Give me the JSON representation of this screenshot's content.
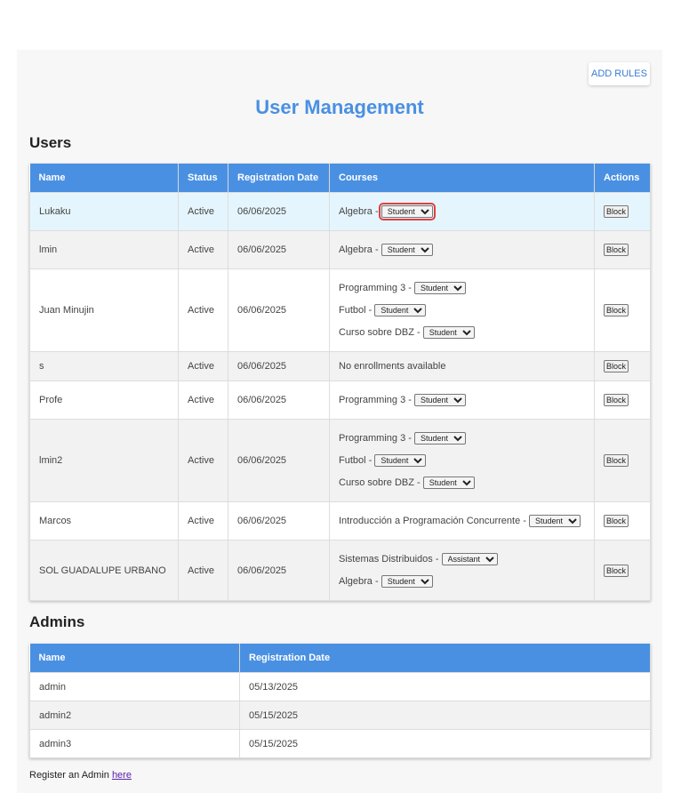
{
  "header": {
    "add_rules_label": "ADD RULES",
    "title": "User Management"
  },
  "users_section": {
    "heading": "Users",
    "columns": [
      "Name",
      "Status",
      "Registration Date",
      "Courses",
      "Actions"
    ],
    "block_label": "Block",
    "rows": [
      {
        "name": "Lukaku",
        "status": "Active",
        "date": "06/06/2025",
        "courses": [
          {
            "course": "Algebra - ",
            "role": "Student"
          }
        ]
      },
      {
        "name": "lmin",
        "status": "Active",
        "date": "06/06/2025",
        "courses": [
          {
            "course": "Algebra - ",
            "role": "Student"
          }
        ]
      },
      {
        "name": "Juan Minujin",
        "status": "Active",
        "date": "06/06/2025",
        "courses": [
          {
            "course": "Programming 3 - ",
            "role": "Student"
          },
          {
            "course": "Futbol - ",
            "role": "Student"
          },
          {
            "course": "Curso sobre DBZ - ",
            "role": "Student"
          }
        ]
      },
      {
        "name": "s",
        "status": "Active",
        "date": "06/06/2025",
        "no_enrollments": "No enrollments available"
      },
      {
        "name": "Profe",
        "status": "Active",
        "date": "06/06/2025",
        "courses": [
          {
            "course": "Programming 3 - ",
            "role": "Student"
          }
        ]
      },
      {
        "name": "lmin2",
        "status": "Active",
        "date": "06/06/2025",
        "courses": [
          {
            "course": "Programming 3 - ",
            "role": "Student"
          },
          {
            "course": "Futbol - ",
            "role": "Student"
          },
          {
            "course": "Curso sobre DBZ - ",
            "role": "Student"
          }
        ]
      },
      {
        "name": "Marcos",
        "status": "Active",
        "date": "06/06/2025",
        "courses": [
          {
            "course": "Introducción a Programación Concurrente - ",
            "role": "Student"
          }
        ]
      },
      {
        "name": "SOL GUADALUPE URBANO",
        "status": "Active",
        "date": "06/06/2025",
        "courses": [
          {
            "course": "Sistemas Distribuidos - ",
            "role": "Assistant"
          },
          {
            "course": "Algebra - ",
            "role": "Student"
          }
        ]
      }
    ]
  },
  "admins_section": {
    "heading": "Admins",
    "columns": [
      "Name",
      "Registration Date"
    ],
    "rows": [
      {
        "name": "admin",
        "date": "05/13/2025"
      },
      {
        "name": "admin2",
        "date": "05/15/2025"
      },
      {
        "name": "admin3",
        "date": "05/15/2025"
      }
    ]
  },
  "footer": {
    "register_text": "Register an Admin ",
    "register_link": "here"
  },
  "colors": {
    "header_blue": "#4a90e2",
    "highlight_row": "#e5f5fd",
    "focus_outline": "#e04040"
  }
}
